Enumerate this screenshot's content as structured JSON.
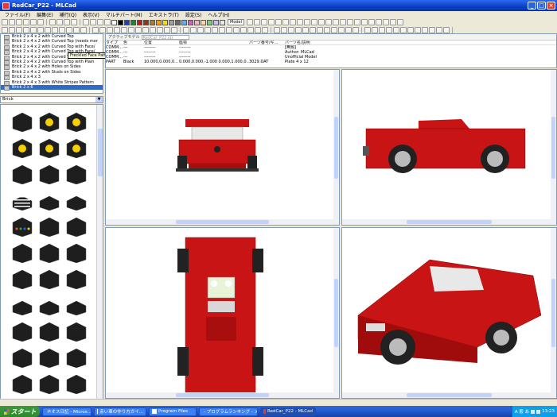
{
  "window": {
    "title": "RedCar_P22 - MLCad"
  },
  "menu": [
    "ファイル(F)",
    "編集(E)",
    "補行(Q)",
    "表示(V)",
    "マルチパート(M)",
    "エキストラ(T)",
    "設定(S)",
    "ヘルプ(H)"
  ],
  "toolbar": {
    "mode_label": "Model"
  },
  "colors": [
    "#ffffff",
    "#000000",
    "#1e3fbf",
    "#1a8a2a",
    "#c61a1a",
    "#8a3a1a",
    "#b07a30",
    "#ff9a00",
    "#f7e000",
    "#a0a0a0",
    "#6a6a6a",
    "#5ab0f0",
    "#d060c0",
    "#f4b0c8",
    "#ffd8a0",
    "#7ad07a",
    "#c0c0ff",
    "#e8e8e8"
  ],
  "parts_tree": {
    "items": [
      "Brick  2 x  4 x  2 with Curved Top",
      "Brick  2 x  4 x  2 with Curved Top (needs mor",
      "Brick  2 x  4 x  2 with Curved Top with Face/",
      "Brick  2 x  4 x  2 with Curved Top with Face/",
      "Brick  2 x  4 x  2 with Curved Top with Freckled Face Pattern",
      "Brick  2 x  4 x  2 with Curved Top with Plain",
      "Brick  2 x  4 x  2 with Holes on Sides",
      "Brick  2 x  4 x  2 with Studs on Sides",
      "Brick  2 x  4 x  3",
      "Brick  2 x  4 x  3 with White Stripes Pattern",
      "Brick  2 x  6"
    ],
    "selected_index": 10,
    "tooltip": "Freckled Face Pattern"
  },
  "category_select": {
    "value": "Brick"
  },
  "model_panel": {
    "tab_label": "アクティブモデル",
    "model_field": "RedCar_P22.ldr",
    "headers": [
      "タイプ",
      "色",
      "位置",
      "座標",
      "パーツ番号/ギ…",
      "パーツ名/説明"
    ],
    "rows": [
      [
        "COMM…",
        "---",
        "--------",
        "--------",
        "",
        "[無題]"
      ],
      [
        "COMM…",
        "---",
        "--------",
        "--------",
        "",
        "Author: MLCad"
      ],
      [
        "COMM…",
        "---",
        "--------",
        "--------",
        "",
        "Unofficial Model"
      ],
      [
        "PART",
        "Black",
        "10.000,0.000,0…",
        "0.000,0.000,-1.000 0.000,1.000,0…",
        "3029.DAT",
        "Plate  4 x 12"
      ]
    ]
  },
  "taskbar": {
    "start_label": "スタート",
    "tasks": [
      "ネオス日記 - Micros...",
      "赤い車の作り方ガイ...",
      "Program Files",
      "- プログラムランキング - メモ帳",
      "RedCar_P22 - MLCad"
    ],
    "active_index": 4,
    "tray_text": "13:23",
    "ime": "A 般 あ"
  }
}
